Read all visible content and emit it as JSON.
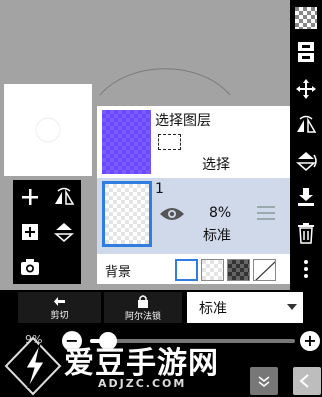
{
  "layer_panel": {
    "selection_layer": {
      "title": "选择图层",
      "label": "选择",
      "thumb_color": "#6a48ff"
    },
    "active_layer": {
      "number": "1",
      "opacity": "8%",
      "blend_mode": "标准",
      "highlight_color": "#cfd9e9",
      "border_color": "#2f7de1"
    },
    "background": {
      "label": "背景",
      "options": [
        "white",
        "checker",
        "dark-checker",
        "none"
      ]
    }
  },
  "bottom_bar": {
    "cut_label": "剪切",
    "alpha_lock_label": "阿尔法锁",
    "blend_select_value": "标准",
    "opacity_pct": "9%",
    "opacity_value": 0.09
  },
  "right_toolbar": {
    "icons": [
      "checker-icon",
      "layers-icon",
      "move-icon",
      "flip-horizontal-icon",
      "flip-vertical-icon",
      "merge-down-icon",
      "trash-icon",
      "more-icon"
    ]
  },
  "left_toolbar": {
    "icons": [
      "add-layer-icon",
      "flip-layer-icon",
      "add-copy-icon",
      "rotate-icon",
      "camera-icon"
    ]
  },
  "watermark": {
    "text": "爱豆手游网",
    "url": "ADJZC.COM"
  }
}
